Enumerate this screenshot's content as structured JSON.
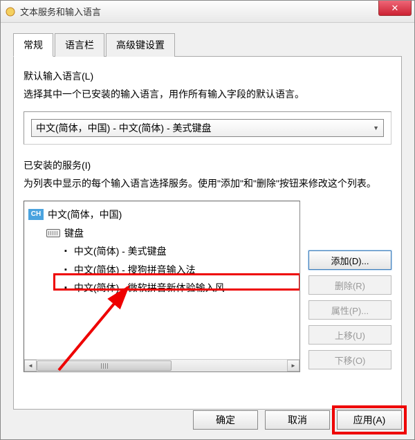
{
  "window": {
    "title": "文本服务和输入语言"
  },
  "tabs": {
    "items": [
      {
        "label": "常规"
      },
      {
        "label": "语言栏"
      },
      {
        "label": "高级键设置"
      }
    ]
  },
  "default_lang": {
    "label": "默认输入语言(L)",
    "desc": "选择其中一个已安装的输入语言，用作所有输入字段的默认语言。",
    "selected": "中文(简体，中国) - 中文(简体) - 美式键盘"
  },
  "installed": {
    "label": "已安装的服务(I)",
    "desc": "为列表中显示的每个输入语言选择服务。使用\"添加\"和\"删除\"按钮来修改这个列表。",
    "tree": {
      "lang_badge": "CH",
      "lang": "中文(简体，中国)",
      "keyboard_label": "键盘",
      "items": [
        "中文(简体) - 美式键盘",
        "中文(简体) - 搜狗拼音输入法",
        "中文(简体) - 微软拼音新体验输入风"
      ]
    }
  },
  "side_buttons": {
    "add": "添加(D)...",
    "remove": "删除(R)",
    "properties": "属性(P)...",
    "move_up": "上移(U)",
    "move_down": "下移(O)"
  },
  "dialog_buttons": {
    "ok": "确定",
    "cancel": "取消",
    "apply": "应用(A)"
  }
}
